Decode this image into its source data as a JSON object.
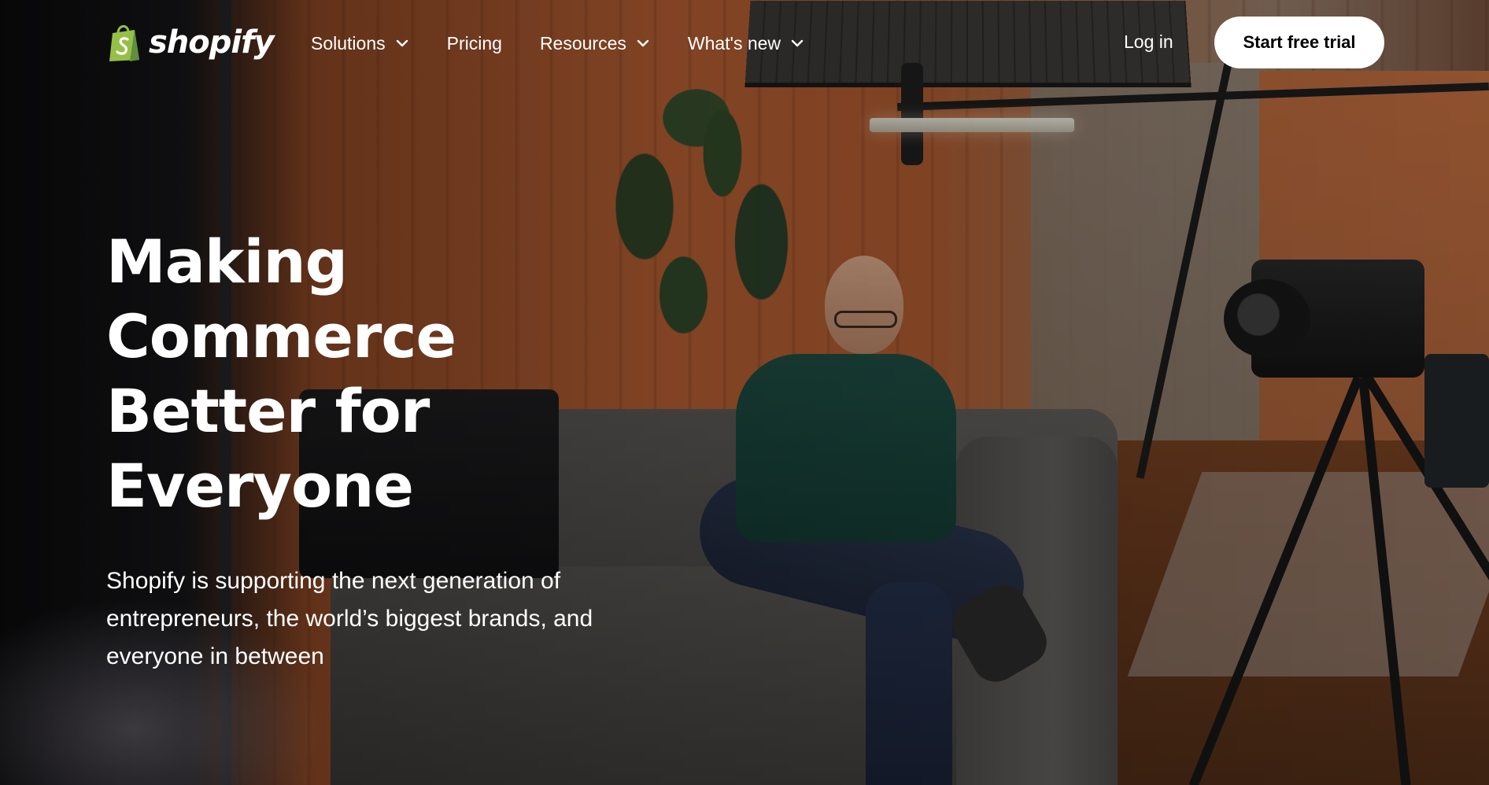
{
  "brand": {
    "name": "shopify",
    "logo_color": "#95bf47"
  },
  "nav": {
    "items": [
      {
        "label": "Solutions",
        "has_dropdown": true,
        "icon": "chevron-down-icon"
      },
      {
        "label": "Pricing",
        "has_dropdown": false
      },
      {
        "label": "Resources",
        "has_dropdown": true,
        "icon": "chevron-down-icon"
      },
      {
        "label": "What's new",
        "has_dropdown": true,
        "icon": "chevron-down-icon"
      }
    ],
    "login_label": "Log in",
    "cta_label": "Start free trial"
  },
  "hero": {
    "title_lines": [
      "Making",
      "Commerce",
      "Better for",
      "Everyone"
    ],
    "subtitle": "Shopify is supporting the next generation of entrepreneurs, the world’s biggest brands, and everyone in between"
  },
  "colors": {
    "text": "#ffffff",
    "cta_bg": "#ffffff",
    "cta_text": "#000000"
  }
}
